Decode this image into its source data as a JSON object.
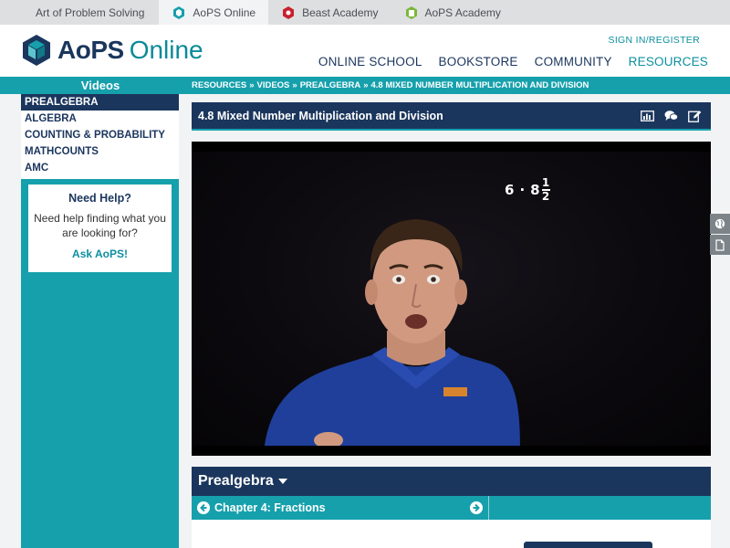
{
  "sitebar": {
    "sites": [
      {
        "label": "Art of Problem Solving",
        "active": false
      },
      {
        "label": "AoPS Online",
        "active": true
      },
      {
        "label": "Beast Academy",
        "active": false
      },
      {
        "label": "AoPS Academy",
        "active": false
      }
    ]
  },
  "header": {
    "logo_part1": "AoPS",
    "logo_part2": "Online",
    "signin": "SIGN IN/REGISTER",
    "nav": [
      "ONLINE SCHOOL",
      "BOOKSTORE",
      "COMMUNITY",
      "RESOURCES"
    ],
    "active_nav": "RESOURCES"
  },
  "band": {
    "title": "Videos",
    "crumbs": [
      "RESOURCES",
      "VIDEOS",
      "PREALGEBRA",
      "4.8 MIXED NUMBER MULTIPLICATION AND DIVISION"
    ],
    "separator": "»"
  },
  "sidebar": {
    "items": [
      "PREALGEBRA",
      "ALGEBRA",
      "COUNTING & PROBABILITY",
      "MATHCOUNTS",
      "AMC"
    ],
    "active": "PREALGEBRA",
    "help": {
      "title": "Need Help?",
      "text": "Need help finding what you are looking for?",
      "link": "Ask AoPS!"
    }
  },
  "video": {
    "title": "4.8 Mixed Number Multiplication and Division",
    "tools": [
      "bar-chart-icon",
      "comments-icon",
      "edit-icon"
    ],
    "math": {
      "a": "6",
      "op": "·",
      "whole": "8",
      "num": "1",
      "den": "2"
    }
  },
  "course": {
    "title": "Prealgebra",
    "chapter": "Chapter 4: Fractions"
  },
  "colors": {
    "navy": "#1b365d",
    "teal": "#16a0ac",
    "link": "#0d8fa0"
  }
}
